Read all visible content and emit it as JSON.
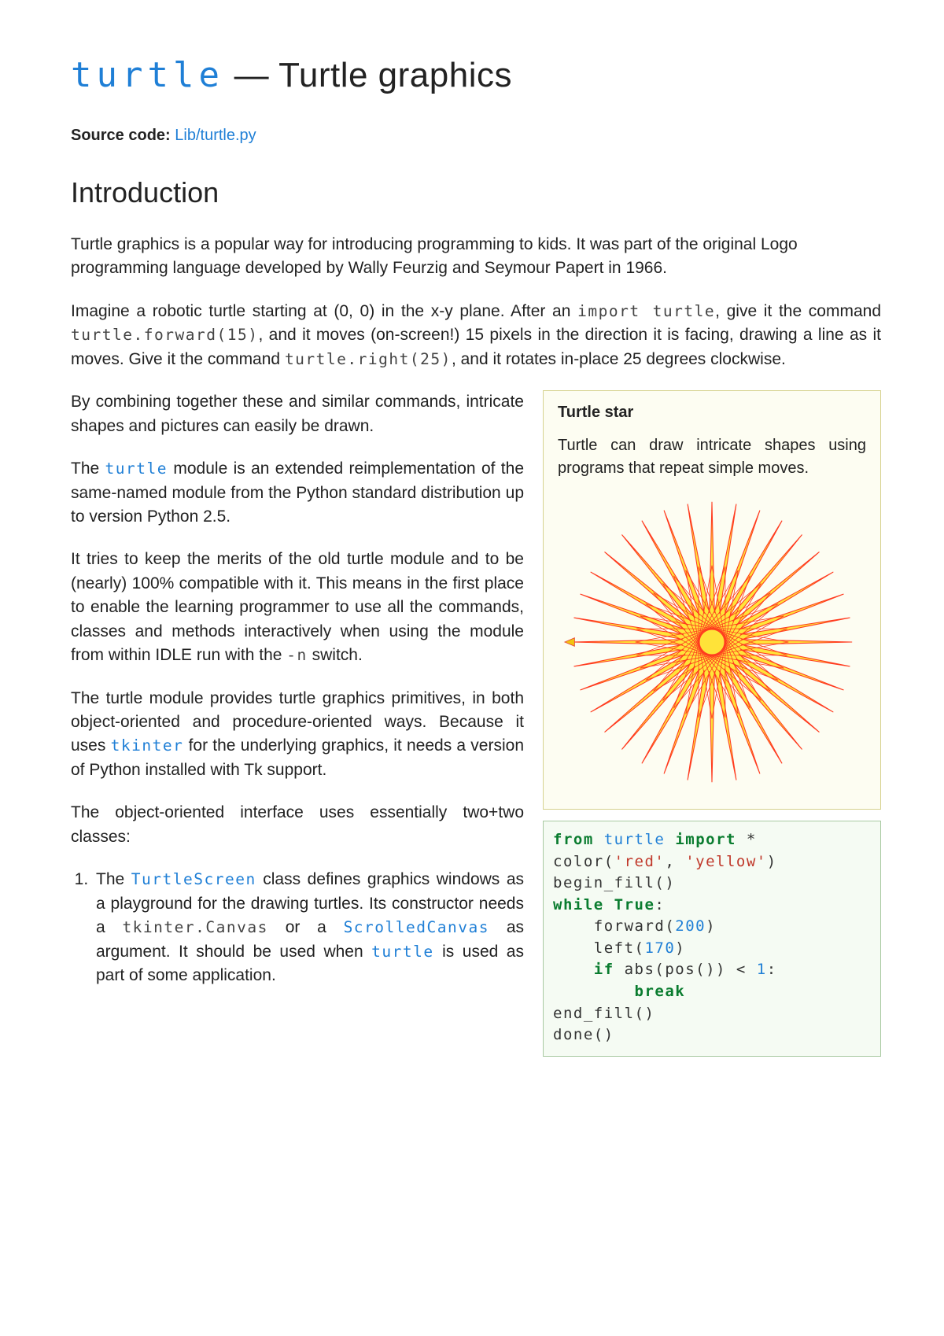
{
  "title": {
    "module": "turtle",
    "dash": " — ",
    "rest": "Turtle graphics"
  },
  "source": {
    "label": "Source code:",
    "link": "Lib/turtle.py"
  },
  "section_intro": "Introduction",
  "para1": "Turtle graphics is a popular way for introducing programming to kids. It was part of the original Logo programming language developed by Wally Feurzig and Seymour Papert in 1966.",
  "para2": {
    "a": "Imagine a robotic turtle starting at (0, 0) in the x-y plane. After an ",
    "c1": "import turtle",
    "b": ", give it the command ",
    "c2": "turtle.forward(15)",
    "c": ", and it moves (on-screen!) 15 pixels in the direction it is facing, drawing a line as it moves. Give it the command ",
    "c3": "turtle.right(25)",
    "d": ", and it rotates in-place 25 degrees clockwise."
  },
  "left": {
    "p1": "By combining together these and similar commands, intricate shapes and pictures can easily be drawn.",
    "p2a": "The ",
    "p2m": "turtle",
    "p2b": " module is an extended reimplementation of the same-named module from the Python standard distribution up to version Python 2.5.",
    "p3a": "It tries to keep the merits of the old turtle module and to be (nearly) 100% compatible with it. This means in the first place to enable the learning programmer to use all the commands, classes and methods interactively when using the module from within IDLE run with the ",
    "p3c": "-n",
    "p3b": " switch.",
    "p4a": "The turtle module provides turtle graphics primitives, in both object-oriented and procedure-oriented ways. Because it uses ",
    "p4m": "tkinter",
    "p4b": " for the underlying graphics, it needs a version of Python installed with Tk support.",
    "p5": "The object-oriented interface uses essentially two+two classes:",
    "li1a": "The ",
    "li1m1": "TurtleScreen",
    "li1b": " class defines graphics windows as a playground for the drawing turtles. Its constructor needs a ",
    "li1m2": "tkinter.Canvas",
    "li1c": " or a ",
    "li1m3": "ScrolledCanvas",
    "li1d": " as argument. It should be used when ",
    "li1m4": "turtle",
    "li1e": " is used as part of some application."
  },
  "sidebar": {
    "title": "Turtle star",
    "text": "Turtle can draw intricate shapes using programs that repeat simple moves."
  },
  "code": {
    "l1_from": "from",
    "l1_mod": "turtle",
    "l1_import": "import",
    "l1_star": " *",
    "l2_a": "color(",
    "l2_s1": "'red'",
    "l2_c": ", ",
    "l2_s2": "'yellow'",
    "l2_b": ")",
    "l3": "begin_fill()",
    "l4_while": "while",
    "l4_true": "True",
    "l4_colon": ":",
    "l5_a": "    forward(",
    "l5_n": "200",
    "l5_b": ")",
    "l6_a": "    left(",
    "l6_n": "170",
    "l6_b": ")",
    "l7_if": "    if",
    "l7_a": " abs(pos()) < ",
    "l7_n": "1",
    "l7_b": ":",
    "l8_break": "        break",
    "l9": "end_fill()",
    "l10": "done()"
  }
}
